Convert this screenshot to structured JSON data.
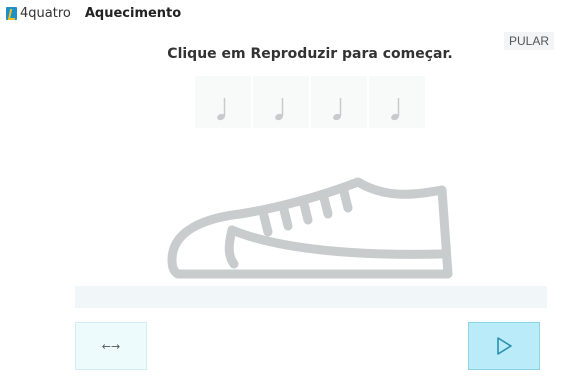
{
  "header": {
    "brand": "4quatro",
    "lesson_title": "Aquecimento",
    "skip_label": "PULAR"
  },
  "instruction": "Clique em Reproduzir para começar.",
  "notes": [
    {
      "icon": "quarter-note-icon"
    },
    {
      "icon": "quarter-note-icon"
    },
    {
      "icon": "quarter-note-icon"
    },
    {
      "icon": "quarter-note-icon"
    }
  ],
  "controls": {
    "swap_symbol": "←→",
    "swap_icon": "swap-arrows-icon",
    "play_icon": "play-icon"
  },
  "colors": {
    "accent": "#1e90c8",
    "play_bg": "#b9ecf8",
    "illustration": "#c9cccc"
  }
}
